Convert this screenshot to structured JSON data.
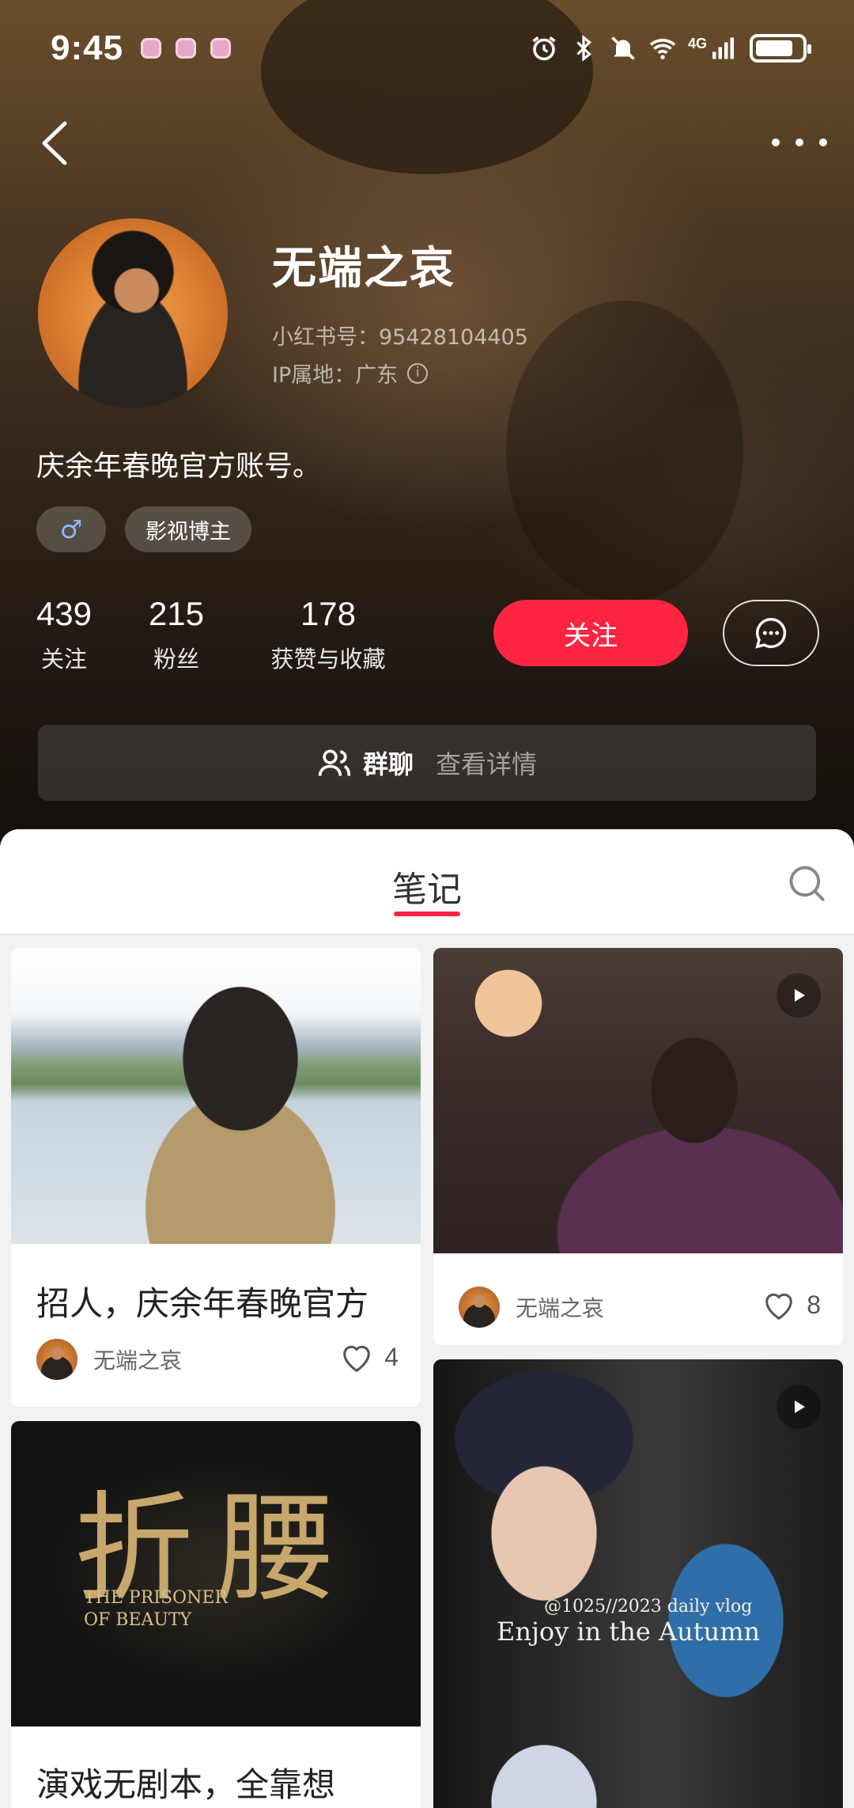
{
  "status_bar": {
    "time": "9:45",
    "network_label": "4G",
    "icons": [
      "alarm-icon",
      "bluetooth-icon",
      "mute-icon",
      "wifi-icon",
      "signal-icon",
      "battery-icon"
    ]
  },
  "profile": {
    "name": "无端之哀",
    "red_id": "小红书号：95428104405",
    "ip_location": "IP属地：广东",
    "bio": "庆余年春晚官方账号。",
    "gender_symbol": "♂",
    "tag": "影视博主"
  },
  "stats": [
    {
      "value": "439",
      "label": "关注"
    },
    {
      "value": "215",
      "label": "粉丝"
    },
    {
      "value": "178",
      "label": "获赞与收藏"
    }
  ],
  "actions": {
    "follow_label": "关注"
  },
  "group_chat": {
    "title": "群聊",
    "link": "查看详情"
  },
  "tabs": {
    "notes_label": "笔记"
  },
  "notes": [
    {
      "title": "招人，庆余年春晚官方",
      "author": "无端之哀",
      "likes": "4",
      "video": false
    },
    {
      "title": "",
      "author": "无端之哀",
      "likes": "8",
      "video": true
    },
    {
      "title": "演戏无剧本，全靠想",
      "author": "",
      "likes": "",
      "video": false
    },
    {
      "title": "",
      "author": "",
      "likes": "",
      "video": true
    }
  ],
  "image_texts": {
    "prisoner_cn": "折腰",
    "prisoner_en": "THE PRISONER OF BEAUTY",
    "collage_line1": "@1025//2023 daily vlog",
    "collage_line2": "Enjoy in the Autumn"
  },
  "colors": {
    "accent": "#ff2442",
    "panel_bg": "#f2f2f2",
    "card_bg": "#ffffff"
  }
}
